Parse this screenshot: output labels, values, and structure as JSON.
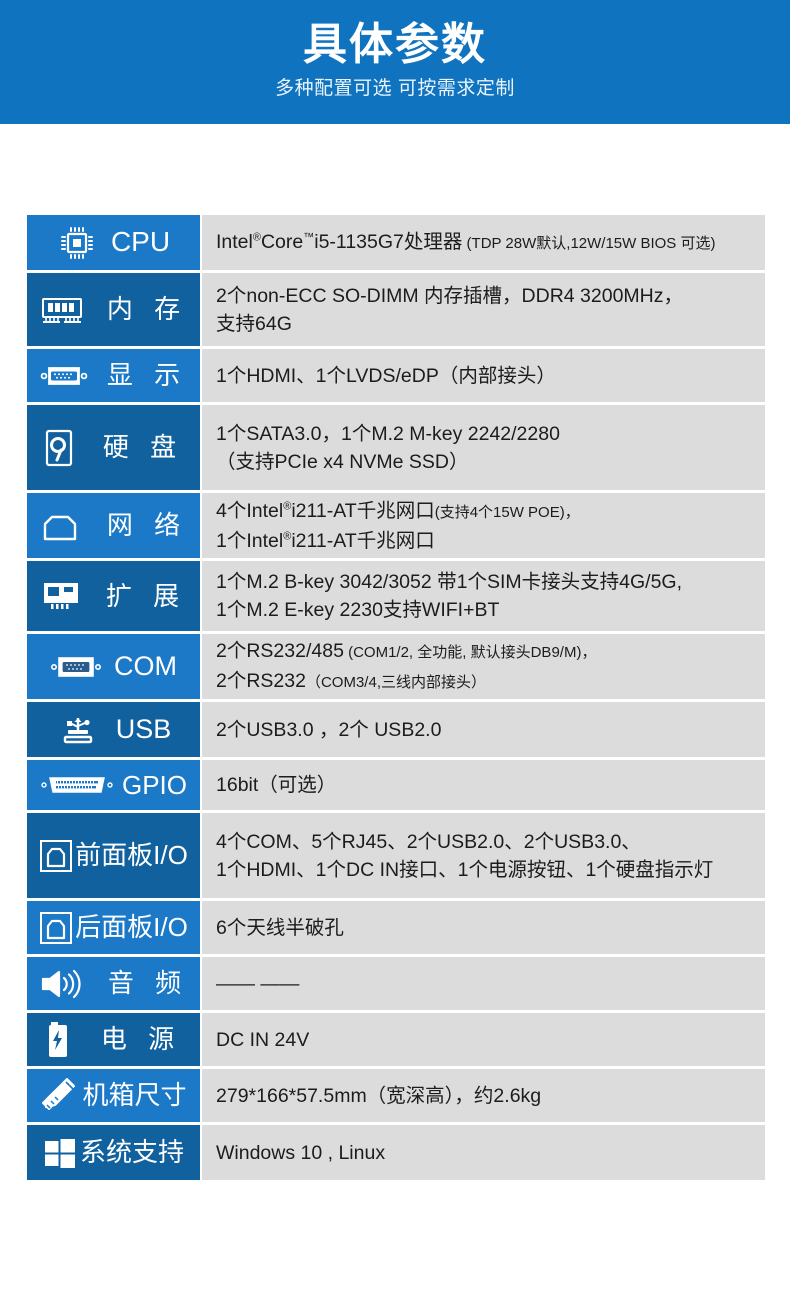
{
  "banner": {
    "title": "具体参数",
    "subtitle": "多种配置可选 可按需求定制",
    "bg_color": "#0f73bf"
  },
  "colors": {
    "label_light": "#1b79c8",
    "label_dark": "#11619f",
    "value_bg": "#dcdcdc",
    "value_text": "#1c1c1c",
    "label_text": "#ffffff"
  },
  "spec_rows": [
    {
      "icon": "cpu-chip-icon",
      "label": "CPU",
      "shade": "light",
      "lines": [
        {
          "main": "Intel®Core™i5-1135G7处理器",
          "note": " (TDP 28W默认,12W/15W BIOS 可选)"
        }
      ]
    },
    {
      "icon": "memory-ram-icon",
      "label": "内 存",
      "shade": "dark",
      "lines": [
        {
          "main": "2个non-ECC SO-DIMM 内存插槽，DDR4 3200MHz，",
          "note": ""
        },
        {
          "main": "支持64G",
          "note": ""
        }
      ]
    },
    {
      "icon": "vga-display-icon",
      "label": "显 示",
      "shade": "light",
      "lines": [
        {
          "main": "1个HDMI、1个LVDS/eDP（内部接头）",
          "note": ""
        }
      ]
    },
    {
      "icon": "hard-disk-icon",
      "label": "硬 盘",
      "shade": "dark",
      "lines": [
        {
          "main": "1个SATA3.0，1个M.2 M-key 2242/2280",
          "note": ""
        },
        {
          "main": "（支持PCIe x4 NVMe SSD）",
          "note": ""
        }
      ]
    },
    {
      "icon": "rj45-network-icon",
      "label": "网 络",
      "shade": "light",
      "lines": [
        {
          "main": "4个Intel®i211-AT千兆网口",
          "note": "(支持4个15W POE)，"
        },
        {
          "main": "1个Intel®i211-AT千兆网口",
          "note": ""
        }
      ]
    },
    {
      "icon": "expansion-card-icon",
      "label": "扩 展",
      "shade": "dark",
      "lines": [
        {
          "main": "1个M.2 B-key 3042/3052 带1个SIM卡接头支持4G/5G,",
          "note": ""
        },
        {
          "main": "1个M.2 E-key 2230支持WIFI+BT",
          "note": ""
        }
      ]
    },
    {
      "icon": "db9-serial-icon",
      "label": "COM",
      "shade": "light",
      "lines": [
        {
          "main": "2个RS232/485",
          "note": " (COM1/2, 全功能, 默认接头DB9/M)，"
        },
        {
          "main": "2个RS232",
          "note": "（COM3/4,三线内部接头）"
        }
      ]
    },
    {
      "icon": "usb-trident-icon",
      "label": "USB",
      "shade": "dark",
      "lines": [
        {
          "main": "2个USB3.0 ，2个 USB2.0",
          "note": ""
        }
      ]
    },
    {
      "icon": "gpio-connector-icon",
      "label": "GPIO",
      "shade": "light",
      "lines": [
        {
          "main": "16bit（可选）",
          "note": ""
        }
      ]
    },
    {
      "icon": "front-panel-io-icon",
      "label": "前面板I/O",
      "shade": "dark",
      "lines": [
        {
          "main": "4个COM、5个RJ45、2个USB2.0、2个USB3.0、",
          "note": ""
        },
        {
          "main": "1个HDMI、1个DC IN接口、1个电源按钮、1个硬盘指示灯",
          "note": ""
        }
      ]
    },
    {
      "icon": "rear-panel-io-icon",
      "label": "后面板I/O",
      "shade": "light",
      "lines": [
        {
          "main": "6个天线半破孔",
          "note": ""
        }
      ]
    },
    {
      "icon": "audio-speaker-icon",
      "label": "音 频",
      "shade": "light",
      "lines": [
        {
          "main": "—— ——",
          "note": ""
        }
      ]
    },
    {
      "icon": "power-battery-icon",
      "label": "电 源",
      "shade": "dark",
      "lines": [
        {
          "main": "DC IN 24V",
          "note": ""
        }
      ]
    },
    {
      "icon": "ruler-pencil-icon",
      "label": "机箱尺寸",
      "shade": "light",
      "lines": [
        {
          "main": "279*166*57.5mm（宽深高），约2.6kg",
          "note": ""
        }
      ]
    },
    {
      "icon": "windows-logo-icon",
      "label": "系统支持",
      "shade": "dark",
      "lines": [
        {
          "main": "Windows 10 , Linux",
          "note": ""
        }
      ]
    }
  ]
}
